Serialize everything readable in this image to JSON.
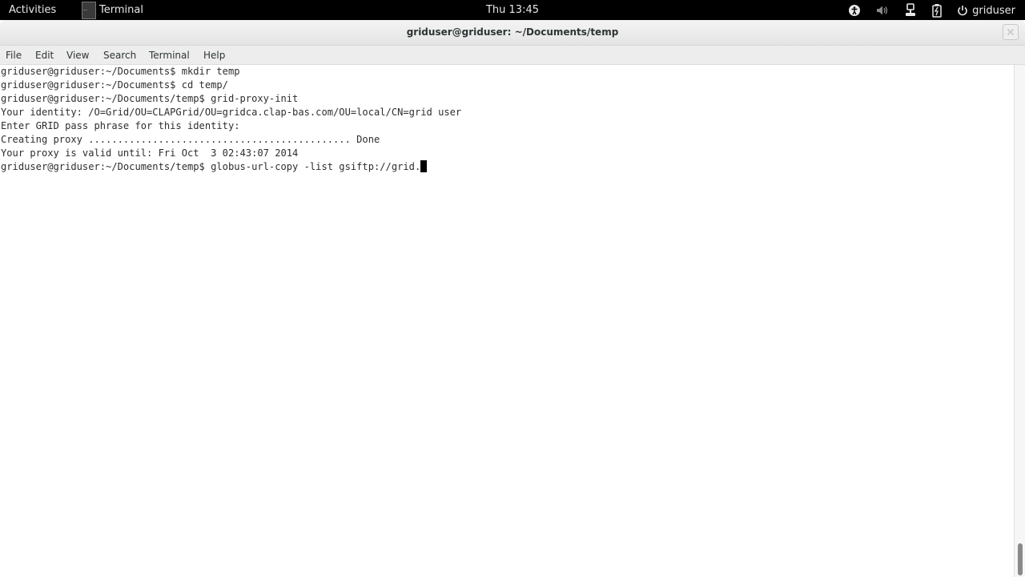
{
  "topbar": {
    "activities": "Activities",
    "app_name": "Terminal",
    "app_icon_glyph": "_",
    "clock": "Thu 13:45",
    "user": "griduser",
    "tray_icons": [
      "accessibility-icon",
      "volume-icon",
      "network-icon",
      "battery-icon",
      "power-icon"
    ]
  },
  "window": {
    "title": "griduser@griduser: ~/Documents/temp",
    "close_glyph": "✕"
  },
  "menu": {
    "file": "File",
    "edit": "Edit",
    "view": "View",
    "search": "Search",
    "terminal": "Terminal",
    "help": "Help"
  },
  "terminal": {
    "lines": [
      "griduser@griduser:~/Documents$ mkdir temp",
      "griduser@griduser:~/Documents$ cd temp/",
      "griduser@griduser:~/Documents/temp$ grid-proxy-init",
      "Your identity: /O=Grid/OU=CLAPGrid/OU=gridca.clap-bas.com/OU=local/CN=grid user",
      "Enter GRID pass phrase for this identity:",
      "Creating proxy ............................................. Done",
      "Your proxy is valid until: Fri Oct  3 02:43:07 2014"
    ],
    "current_prompt": "griduser@griduser:~/Documents/temp$ ",
    "current_input": "globus-url-copy -list gsiftp://grid."
  },
  "colors": {
    "topbar_bg": "#000000",
    "terminal_bg": "#ffffff",
    "terminal_fg": "#2e2e2e"
  }
}
